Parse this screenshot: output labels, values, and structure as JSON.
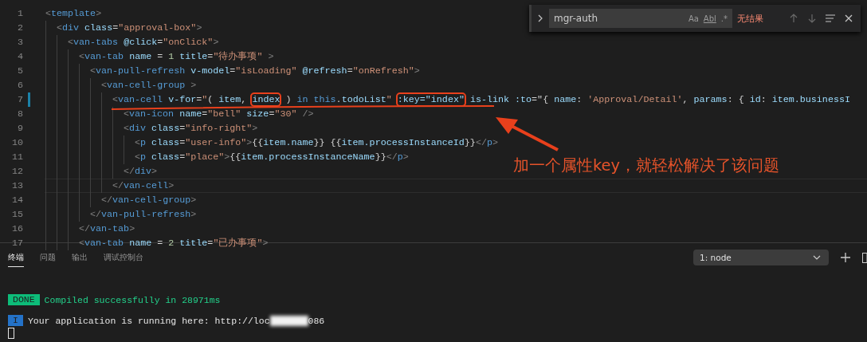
{
  "editor": {
    "lines": [
      {
        "number": "1",
        "current": false,
        "modified": false,
        "tokens": [
          {
            "kind": "punct",
            "text": "<"
          },
          {
            "kind": "tag",
            "text": "template"
          },
          {
            "kind": "punct",
            "text": ">"
          }
        ]
      },
      {
        "number": "2",
        "current": false,
        "modified": false,
        "tokens": [
          {
            "kind": "punct",
            "text": "  <"
          },
          {
            "kind": "tag",
            "text": "div"
          },
          {
            "kind": "attr",
            "text": " class"
          },
          {
            "kind": "plain",
            "text": "="
          },
          {
            "kind": "string",
            "text": "\"approval-box\""
          },
          {
            "kind": "punct",
            "text": ">"
          }
        ]
      },
      {
        "number": "3",
        "current": false,
        "modified": false,
        "tokens": [
          {
            "kind": "punct",
            "text": "    <"
          },
          {
            "kind": "tag",
            "text": "van-tabs"
          },
          {
            "kind": "attr",
            "text": " @click"
          },
          {
            "kind": "plain",
            "text": "="
          },
          {
            "kind": "string",
            "text": "\"onClick\""
          },
          {
            "kind": "punct",
            "text": ">"
          }
        ]
      },
      {
        "number": "4",
        "current": false,
        "modified": false,
        "tokens": [
          {
            "kind": "punct",
            "text": "      <"
          },
          {
            "kind": "tag",
            "text": "van-tab"
          },
          {
            "kind": "attr",
            "text": " name"
          },
          {
            "kind": "plain",
            "text": " = "
          },
          {
            "kind": "number",
            "text": "1"
          },
          {
            "kind": "attr",
            "text": " title"
          },
          {
            "kind": "plain",
            "text": "="
          },
          {
            "kind": "string",
            "text": "\"待办事项\""
          },
          {
            "kind": "punct",
            "text": " >"
          }
        ]
      },
      {
        "number": "5",
        "current": false,
        "modified": false,
        "tokens": [
          {
            "kind": "punct",
            "text": "        <"
          },
          {
            "kind": "tag",
            "text": "van-pull-refresh"
          },
          {
            "kind": "attr",
            "text": " v-model"
          },
          {
            "kind": "plain",
            "text": "="
          },
          {
            "kind": "string",
            "text": "\"isLoading\""
          },
          {
            "kind": "attr",
            "text": " @refresh"
          },
          {
            "kind": "plain",
            "text": "="
          },
          {
            "kind": "string",
            "text": "\"onRefresh\""
          },
          {
            "kind": "punct",
            "text": ">"
          }
        ]
      },
      {
        "number": "6",
        "current": false,
        "modified": false,
        "tokens": [
          {
            "kind": "punct",
            "text": "          <"
          },
          {
            "kind": "tag",
            "text": "van-cell-group"
          },
          {
            "kind": "punct",
            "text": " >"
          }
        ]
      },
      {
        "number": "7",
        "current": false,
        "modified": true,
        "tokens": [
          {
            "kind": "punct",
            "text": "            <"
          },
          {
            "kind": "tag",
            "text": "van-cell"
          },
          {
            "kind": "attr",
            "text": " v-for"
          },
          {
            "kind": "plain",
            "text": "="
          },
          {
            "kind": "string",
            "text": "\""
          },
          {
            "kind": "plain",
            "text": "( "
          },
          {
            "kind": "var",
            "text": "item"
          },
          {
            "kind": "plain",
            "text": ", "
          },
          {
            "kind": "var",
            "text": "index",
            "boxed": true
          },
          {
            "kind": "plain",
            "text": " ) "
          },
          {
            "kind": "keyword",
            "text": "in this"
          },
          {
            "kind": "plain",
            "text": "."
          },
          {
            "kind": "var",
            "text": "todoList"
          },
          {
            "kind": "string",
            "text": "\" "
          },
          {
            "kind": "attr",
            "text": ":key=\"index\"",
            "boxed": true
          },
          {
            "kind": "attr",
            "text": " is-link :to"
          },
          {
            "kind": "plain",
            "text": "=\"{ "
          },
          {
            "kind": "var",
            "text": "name"
          },
          {
            "kind": "plain",
            "text": ": "
          },
          {
            "kind": "string",
            "text": "'Approval/Detail'"
          },
          {
            "kind": "plain",
            "text": ", "
          },
          {
            "kind": "var",
            "text": "params"
          },
          {
            "kind": "plain",
            "text": ": { "
          },
          {
            "kind": "var",
            "text": "id"
          },
          {
            "kind": "plain",
            "text": ": "
          },
          {
            "kind": "var",
            "text": "item.businessI"
          }
        ]
      },
      {
        "number": "8",
        "current": false,
        "modified": false,
        "tokens": [
          {
            "kind": "punct",
            "text": "              <"
          },
          {
            "kind": "tag",
            "text": "van-icon"
          },
          {
            "kind": "attr",
            "text": " name"
          },
          {
            "kind": "plain",
            "text": "="
          },
          {
            "kind": "string",
            "text": "\"bell\""
          },
          {
            "kind": "attr",
            "text": " size"
          },
          {
            "kind": "plain",
            "text": "="
          },
          {
            "kind": "string",
            "text": "\"30\""
          },
          {
            "kind": "punct",
            "text": " />"
          }
        ]
      },
      {
        "number": "9",
        "current": false,
        "modified": false,
        "tokens": [
          {
            "kind": "punct",
            "text": "              <"
          },
          {
            "kind": "tag",
            "text": "div"
          },
          {
            "kind": "attr",
            "text": " class"
          },
          {
            "kind": "plain",
            "text": "="
          },
          {
            "kind": "string",
            "text": "\"info-right\""
          },
          {
            "kind": "punct",
            "text": ">"
          }
        ]
      },
      {
        "number": "10",
        "current": false,
        "modified": false,
        "tokens": [
          {
            "kind": "punct",
            "text": "                <"
          },
          {
            "kind": "tag",
            "text": "p"
          },
          {
            "kind": "attr",
            "text": " class"
          },
          {
            "kind": "plain",
            "text": "="
          },
          {
            "kind": "string",
            "text": "\"user-info\""
          },
          {
            "kind": "punct",
            "text": ">"
          },
          {
            "kind": "plain",
            "text": "{{"
          },
          {
            "kind": "var",
            "text": "item.name"
          },
          {
            "kind": "plain",
            "text": "}} {{"
          },
          {
            "kind": "var",
            "text": "item.processInstanceId"
          },
          {
            "kind": "plain",
            "text": "}}"
          },
          {
            "kind": "punct",
            "text": "</"
          },
          {
            "kind": "tag",
            "text": "p"
          },
          {
            "kind": "punct",
            "text": ">"
          }
        ]
      },
      {
        "number": "11",
        "current": false,
        "modified": false,
        "tokens": [
          {
            "kind": "punct",
            "text": "                <"
          },
          {
            "kind": "tag",
            "text": "p"
          },
          {
            "kind": "attr",
            "text": " class"
          },
          {
            "kind": "plain",
            "text": "="
          },
          {
            "kind": "string",
            "text": "\"place\""
          },
          {
            "kind": "punct",
            "text": ">"
          },
          {
            "kind": "plain",
            "text": "{{"
          },
          {
            "kind": "var",
            "text": "item.processInstanceName"
          },
          {
            "kind": "plain",
            "text": "}}"
          },
          {
            "kind": "punct",
            "text": "</"
          },
          {
            "kind": "tag",
            "text": "p"
          },
          {
            "kind": "punct",
            "text": ">"
          }
        ]
      },
      {
        "number": "12",
        "current": false,
        "modified": false,
        "tokens": [
          {
            "kind": "punct",
            "text": "              </"
          },
          {
            "kind": "tag",
            "text": "div"
          },
          {
            "kind": "punct",
            "text": ">"
          }
        ]
      },
      {
        "number": "13",
        "current": true,
        "modified": false,
        "tokens": [
          {
            "kind": "punct",
            "text": "            </"
          },
          {
            "kind": "tag",
            "text": "van-cell"
          },
          {
            "kind": "punct",
            "text": ">"
          }
        ]
      },
      {
        "number": "14",
        "current": false,
        "modified": false,
        "tokens": [
          {
            "kind": "punct",
            "text": "          </"
          },
          {
            "kind": "tag",
            "text": "van-cell-group"
          },
          {
            "kind": "punct",
            "text": ">"
          }
        ]
      },
      {
        "number": "15",
        "current": false,
        "modified": false,
        "tokens": [
          {
            "kind": "punct",
            "text": "        </"
          },
          {
            "kind": "tag",
            "text": "van-pull-refresh"
          },
          {
            "kind": "punct",
            "text": ">"
          }
        ]
      },
      {
        "number": "16",
        "current": false,
        "modified": false,
        "tokens": [
          {
            "kind": "punct",
            "text": "      </"
          },
          {
            "kind": "tag",
            "text": "van-tab"
          },
          {
            "kind": "punct",
            "text": ">"
          }
        ]
      },
      {
        "number": "17",
        "current": false,
        "modified": false,
        "tokens": [
          {
            "kind": "punct",
            "text": "      <"
          },
          {
            "kind": "tag",
            "text": "van-tab"
          },
          {
            "kind": "attr",
            "text": " name"
          },
          {
            "kind": "plain",
            "text": " = "
          },
          {
            "kind": "number",
            "text": "2"
          },
          {
            "kind": "attr",
            "text": " title"
          },
          {
            "kind": "plain",
            "text": "="
          },
          {
            "kind": "string",
            "text": "\"已办事项\""
          },
          {
            "kind": "punct",
            "text": ">"
          }
        ]
      }
    ]
  },
  "find_widget": {
    "value": "mgr-auth",
    "options": [
      "Aa",
      "Abl",
      ".*"
    ],
    "result": "无结果"
  },
  "annotation": {
    "text": "加一个属性key，就轻松解决了该问题"
  },
  "panel": {
    "tabs": [
      {
        "label": "终端",
        "selected": true
      },
      {
        "label": "问题",
        "selected": false
      },
      {
        "label": "输出",
        "selected": false
      },
      {
        "label": "调试控制台",
        "selected": false
      }
    ],
    "terminal_select": "1: node",
    "terminal_lines": [
      {
        "badge": "DONE",
        "kind": "success",
        "text": "Compiled successfully in 28971ms"
      },
      {
        "badge": "I",
        "kind": "info",
        "text": "Your application is running here: http://loc",
        "redacted": true,
        "tail": "086"
      }
    ]
  }
}
